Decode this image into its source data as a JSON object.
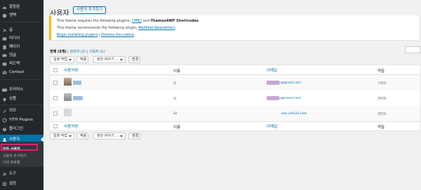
{
  "sidebar": {
    "items": [
      {
        "label": "알림판",
        "icon": "dashboard-icon"
      },
      {
        "label": "젯팩",
        "icon": "jetpack-icon"
      },
      {
        "label": "글",
        "icon": "pin-icon"
      },
      {
        "label": "미디어",
        "icon": "media-icon"
      },
      {
        "label": "페이지",
        "icon": "page-icon"
      },
      {
        "label": "댓글",
        "icon": "comment-icon"
      },
      {
        "label": "피드백",
        "icon": "feedback-icon"
      },
      {
        "label": "Contact",
        "icon": "contact-icon"
      },
      {
        "label": "우커머스",
        "icon": "woocommerce-icon"
      },
      {
        "label": "상품",
        "icon": "products-icon"
      },
      {
        "label": "외모",
        "icon": "appearance-icon"
      },
      {
        "label": "YITH Plugins",
        "icon": "yith-icon"
      },
      {
        "label": "플러그인",
        "icon": "plugins-icon"
      },
      {
        "label": "사용자",
        "icon": "users-icon"
      },
      {
        "label": "도구",
        "icon": "tools-icon"
      },
      {
        "label": "설정",
        "icon": "settings-icon"
      }
    ],
    "submenu": [
      "모든 사용자",
      "사용자 추가하기",
      "나의 프로필"
    ]
  },
  "page": {
    "title": "사용자",
    "add_new": "사용자 추가하기"
  },
  "notice": {
    "line1_pre": "This theme requires the following plugins: ",
    "line1_p1": "CMB2",
    "line1_and": " and ",
    "line1_p2": "Themes4WP Shortcodes",
    "line1_end": ".",
    "line2_pre": "This theme recommends the following plugin: ",
    "line2_p1": "MailPoet Newsletters",
    "line2_end": ".",
    "begin": "Begin installing plugins",
    "sep": " | ",
    "dismiss": "Dismiss this notice"
  },
  "filters": {
    "all": "전체 (3개)",
    "admin": "관리자 (2)",
    "subscriber": "구독자 (1)",
    "divider": " | "
  },
  "bulk": {
    "action": "일괄 작업",
    "apply": "적용",
    "role_change": "권한 바꾸기 ...",
    "change": "변경"
  },
  "table": {
    "headers": {
      "username": "사용자명",
      "name": "이름",
      "email": "이메일",
      "role": "역할"
    },
    "rows": [
      {
        "name": "김",
        "email": "u@gmail.com",
        "role": "구독자"
      },
      {
        "name": "김",
        "email": "u@naver.com",
        "role": "관리자"
      },
      {
        "name": "Se",
        "email": "o4u.cafe24.com",
        "role": "관리자"
      }
    ]
  },
  "colors": {
    "sidebar": "#23282d",
    "accent": "#0073aa",
    "highlight": "#d9246d",
    "notice": "#ffb900"
  }
}
